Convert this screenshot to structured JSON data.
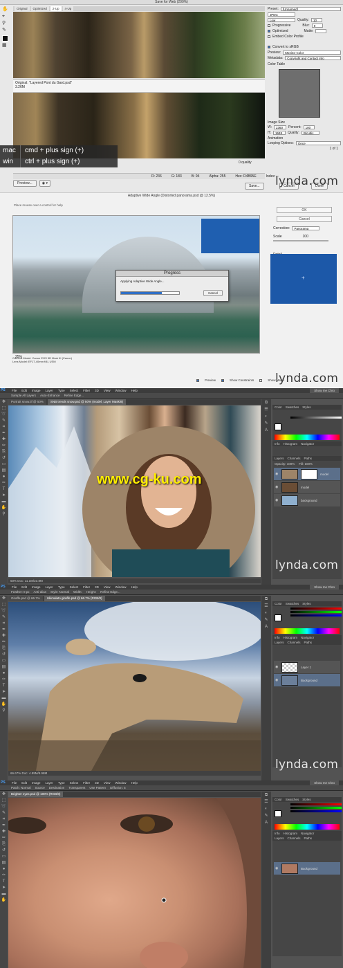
{
  "p1": {
    "title": "Save for Web (200%)",
    "tabs": [
      "Original",
      "Optimized",
      "2-Up",
      "4-Up"
    ],
    "info_text": "Original: \"Layered Pont du Gard.psd\"",
    "info_size": "3.26M",
    "quality_label": "0 quality",
    "status": [
      "R: 236",
      "G: 183",
      "B: 94",
      "Alpha: 255",
      "Hex: D4B95E",
      "Index: --"
    ],
    "preview_label": "Preview...",
    "save_label": "Save...",
    "cancel_label": "Cancel",
    "done_label": "Done",
    "kb_mac_os": "mac",
    "kb_mac_keys": "cmd + plus sign (+)",
    "kb_win_os": "win",
    "kb_win_keys": "ctrl + plus sign (+)",
    "right": {
      "preset_label": "Preset:",
      "preset_value": "[Unnamed]",
      "format": "JPEG",
      "compression": "Low",
      "quality_label": "Quality:",
      "quality_value": "10",
      "progressive": "Progressive",
      "blur_label": "Blur:",
      "blur_value": "0",
      "optimized": "Optimized",
      "matte_label": "Matte:",
      "embed_profile": "Embed Color Profile",
      "convert_srgb": "Convert to sRGB",
      "preview_label": "Preview:",
      "preview_value": "Monitor Color",
      "metadata_label": "Metadata:",
      "metadata_value": "Copyright and Contact Info",
      "color_table": "Color Table",
      "image_size": "Image Size",
      "w_label": "W:",
      "w_value": "2360",
      "percent_label": "Percent:",
      "percent_value": "100",
      "h_label": "H:",
      "h_value": "1648",
      "quality2_label": "Quality:",
      "quality2_value": "Bicubic",
      "animation": "Animation",
      "looping_label": "Looping Options:",
      "looping_value": "Once",
      "frames": "1 of 1"
    }
  },
  "p2": {
    "title": "Adaptive Wide Angle (Distorted panorama.psd @ 12.5%)",
    "hint": "Place mouse over a control for help",
    "ok_label": "OK",
    "cancel_label": "Cancel",
    "correction_label": "Correction:",
    "correction_value": "Panorama",
    "scale_label": "Scale",
    "scale_value": "100",
    "detail_label": "Detail",
    "dialog_title": "Progress",
    "dialog_msg": "Applying Adaptive Wide Angle...",
    "dialog_cancel": "Cancel",
    "zoom": "25%",
    "meta1": "Camera Model: Canon EOS 5D Mark III (Canon)",
    "meta2": "Lens Model: EF17-40mm f/4L USM",
    "chk_preview": "Preview",
    "chk_constraints": "Show Constraints",
    "chk_mesh": "Show Mesh"
  },
  "p3": {
    "menu": [
      "PS",
      "File",
      "Edit",
      "Image",
      "Layer",
      "Type",
      "Select",
      "Filter",
      "3D",
      "View",
      "Window",
      "Help"
    ],
    "opts": [
      "Sample All Layers",
      "Auto-Enhance",
      "Refine Edge..."
    ],
    "tabs": [
      "Portrait snow.tif @ 50%",
      "SNB trends snow.psd @ 50% (model, Layer Mask/8)"
    ],
    "status": "50%   Doc: 11.1M/23.8M",
    "panel_tabs": [
      "Color",
      "Swatches",
      "Styles"
    ],
    "panel_tabs2": [
      "Info",
      "Histogram",
      "Navigator"
    ],
    "panel_tabs3": [
      "Layers",
      "Channels",
      "Paths"
    ],
    "opacity": "Opacity: 100%",
    "fill": "Fill: 100%",
    "layers": [
      "model",
      "model",
      "background"
    ],
    "workspace": "Show me Chro"
  },
  "p4": {
    "menu": [
      "PS",
      "File",
      "Edit",
      "Image",
      "Layer",
      "Type",
      "Select",
      "Filter",
      "3D",
      "View",
      "Window",
      "Help"
    ],
    "opts": [
      "Feather: 0 px",
      "Anti-alias",
      "Style: Normal",
      "Width:",
      "Height:",
      "Refine Edge..."
    ],
    "tabs": [
      "Giraffe.psd @ 66.7%",
      "Ukimalato giraffe.psd @ 66.7% (RGB/8)"
    ],
    "status": "66.67%   Doc: 4.89M/9.98M",
    "panel_tabs": [
      "Color",
      "Swatches",
      "Styles"
    ],
    "panel_tabs2": [
      "Info",
      "Histogram",
      "Navigator"
    ],
    "panel_tabs3": [
      "Layers",
      "Channels",
      "Paths"
    ],
    "layers": [
      "Layer 1",
      "Background"
    ],
    "workspace": "Show me Chro"
  },
  "p5": {
    "menu": [
      "PS",
      "File",
      "Edit",
      "Image",
      "Layer",
      "Type",
      "Select",
      "Filter",
      "3D",
      "View",
      "Window",
      "Help"
    ],
    "opts": [
      "Patch: Normal",
      "Source",
      "Destination",
      "Transparent",
      "Use Pattern",
      "Diffusion: 5"
    ],
    "tabs": [
      "Brighter eyes.psd @ 100% (RGB/8)"
    ],
    "panel_tabs": [
      "Color",
      "Swatches",
      "Styles"
    ],
    "panel_tabs2": [
      "Info",
      "Histogram",
      "Navigator"
    ],
    "panel_tabs3": [
      "Layers",
      "Channels",
      "Paths"
    ],
    "layers": [
      "Background"
    ],
    "workspace": "Show me Chro"
  },
  "brand": "lynda.com",
  "watermark": "www.cg-ku.com",
  "colors": {
    "ps_bg": "#535353",
    "accent": "#2f6fc5",
    "watermark_yellow": "#ffee00"
  }
}
